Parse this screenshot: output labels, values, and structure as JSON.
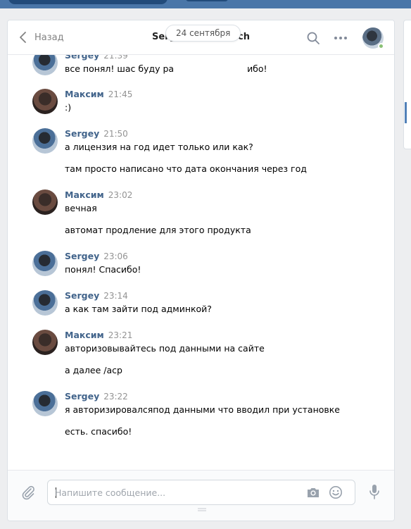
{
  "header": {
    "back_label": "Назад",
    "title": "Sergey Viktorovich",
    "icons": [
      "chevron-left-icon",
      "search-icon",
      "more-icon",
      "avatar",
      "online-indicator"
    ]
  },
  "date_divider": "24 сентября",
  "messages": [
    {
      "author": "Sergey",
      "time": "21:39",
      "lines": [
        "все понял! шас буду ра",
        "ибо!"
      ]
    },
    {
      "author": "Максим",
      "time": "21:45",
      "lines": [
        ":)"
      ]
    },
    {
      "author": "Sergey",
      "time": "21:50",
      "lines": [
        "а лицензия на год идет только или как?",
        "там просто написано что дата окончания через год"
      ]
    },
    {
      "author": "Максим",
      "time": "23:02",
      "lines": [
        "вечная",
        "автомат продление для этого продукта"
      ]
    },
    {
      "author": "Sergey",
      "time": "23:06",
      "lines": [
        "понял! Спасибо!"
      ]
    },
    {
      "author": "Sergey",
      "time": "23:14",
      "lines": [
        "а как там зайти под админкой?"
      ]
    },
    {
      "author": "Максим",
      "time": "23:21",
      "lines": [
        "авторизовывайтесь под данными на сайте",
        "а далее /acp"
      ]
    },
    {
      "author": "Sergey",
      "time": "23:22",
      "lines": [
        "я авторизировалсяпод данными что вводил при установке",
        "есть. спасибо!"
      ]
    }
  ],
  "composer": {
    "placeholder": "Напишите сообщение...",
    "value": "",
    "icons": [
      "attach-icon",
      "camera-icon",
      "smile-icon",
      "microphone-icon"
    ]
  },
  "colors": {
    "topbar": "#4a76a8",
    "author": "#42648b",
    "online": "#8ac176",
    "panel_border": "#dce1e6"
  }
}
